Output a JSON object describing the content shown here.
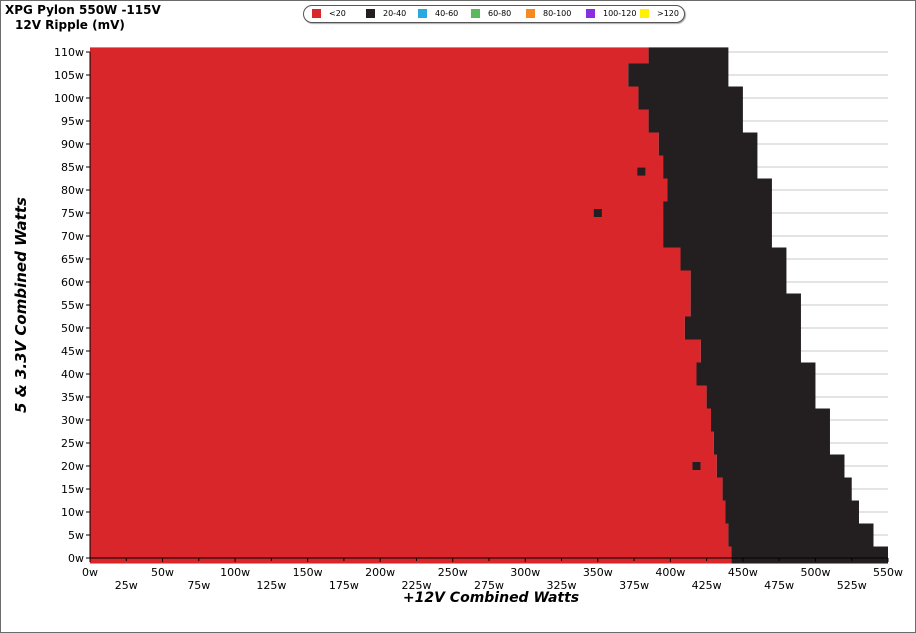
{
  "chart_data": {
    "type": "heatmap",
    "title": "XPG Pylon 550W -115V",
    "subtitle": "12V Ripple (mV)",
    "xlabel": "+12V Combined Watts",
    "ylabel": "5 & 3.3V Combined Watts",
    "xlim": [
      0,
      550
    ],
    "ylim": [
      0,
      110
    ],
    "x_ticks_major": [
      "0w",
      "50w",
      "100w",
      "150w",
      "200w",
      "250w",
      "300w",
      "350w",
      "400w",
      "450w",
      "500w",
      "550w"
    ],
    "x_ticks_minor": [
      "25w",
      "75w",
      "125w",
      "175w",
      "225w",
      "275w",
      "325w",
      "375w",
      "425w",
      "475w",
      "525w"
    ],
    "y_ticks": [
      "0w",
      "5w",
      "10w",
      "15w",
      "20w",
      "25w",
      "30w",
      "35w",
      "40w",
      "45w",
      "50w",
      "55w",
      "60w",
      "65w",
      "70w",
      "75w",
      "80w",
      "85w",
      "90w",
      "95w",
      "100w",
      "105w",
      "110w"
    ],
    "legend": [
      {
        "label": "<20",
        "color": "#d9262a"
      },
      {
        "label": "20-40",
        "color": "#231f20"
      },
      {
        "label": "40-60",
        "color": "#27a9e1"
      },
      {
        "label": "60-80",
        "color": "#5cb85c"
      },
      {
        "label": "80-100",
        "color": "#f58a1f"
      },
      {
        "label": "100-120",
        "color": "#8b2be2"
      },
      {
        "label": ">120",
        "color": "#fff200"
      }
    ],
    "grid": true,
    "region_boundaries": {
      "note_units": "watts",
      "y_points": [
        0,
        5,
        10,
        15,
        20,
        25,
        30,
        35,
        40,
        45,
        50,
        55,
        60,
        65,
        70,
        75,
        80,
        85,
        90,
        95,
        100,
        105,
        110
      ],
      "red_to_black_x": [
        442,
        440,
        438,
        436,
        432,
        430,
        428,
        425,
        418,
        421,
        410,
        414,
        414,
        407,
        395,
        395,
        398,
        395,
        392,
        385,
        378,
        371,
        385
      ],
      "black_to_white_x": [
        550,
        540,
        530,
        525,
        520,
        510,
        510,
        500,
        500,
        490,
        490,
        490,
        480,
        480,
        470,
        470,
        470,
        460,
        460,
        450,
        450,
        440,
        440
      ]
    },
    "outlier_cells": [
      {
        "x": 350,
        "y": 75,
        "range": "20-40"
      },
      {
        "x": 380,
        "y": 84,
        "range": "20-40"
      },
      {
        "x": 418,
        "y": 20,
        "range": "20-40"
      }
    ]
  }
}
